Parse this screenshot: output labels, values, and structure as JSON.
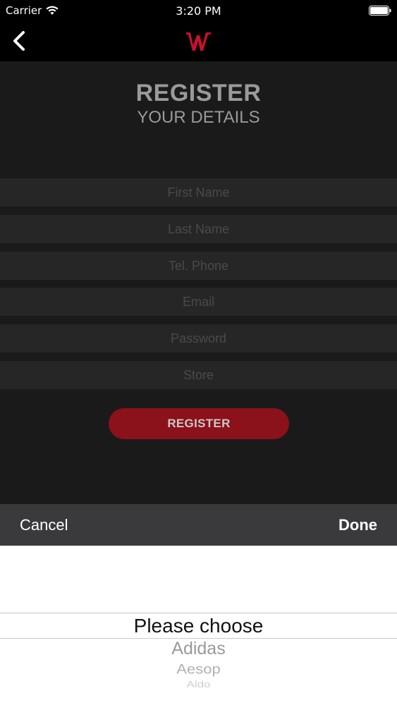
{
  "status_bar": {
    "carrier": "Carrier",
    "time": "3:20 PM",
    "wifi_icon": "wifi-icon",
    "battery_icon": "battery-icon"
  },
  "nav": {
    "back_icon": "chevron-left-icon",
    "logo_icon": "w-logo-icon",
    "logo_color": "#c8102e"
  },
  "header": {
    "title": "REGISTER",
    "subtitle": "YOUR DETAILS"
  },
  "form": {
    "first_name": {
      "placeholder": "First Name",
      "value": ""
    },
    "last_name": {
      "placeholder": "Last Name",
      "value": ""
    },
    "phone": {
      "placeholder": "Tel. Phone",
      "value": ""
    },
    "email": {
      "placeholder": "Email",
      "value": ""
    },
    "password": {
      "placeholder": "Password",
      "value": ""
    },
    "store": {
      "placeholder": "Store",
      "value": ""
    }
  },
  "register_button": {
    "label": "REGISTER",
    "color": "#8b111a"
  },
  "picker_toolbar": {
    "cancel_label": "Cancel",
    "done_label": "Done"
  },
  "picker": {
    "selected": "Please choose",
    "options": [
      "Adidas",
      "Aesop",
      "Aldo"
    ]
  }
}
